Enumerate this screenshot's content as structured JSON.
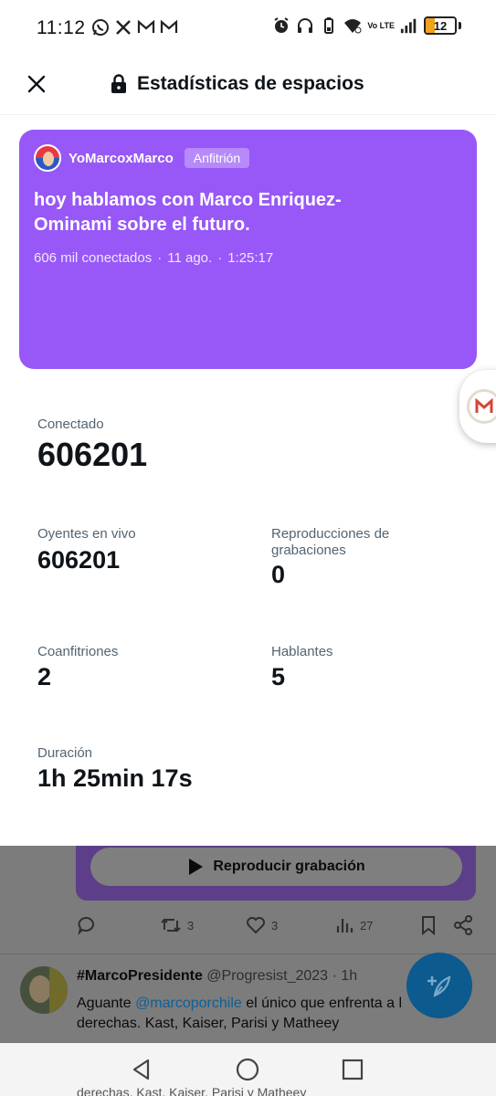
{
  "status_bar": {
    "time": "11:12",
    "battery": "12",
    "network": "Vo LTE"
  },
  "header": {
    "title": "Estadísticas de espacios"
  },
  "space": {
    "host_name": "YoMarcoxMarco",
    "host_badge": "Anfitrión",
    "title": "hoy hablamos con Marco Enriquez-Ominami sobre el futuro.",
    "connected": "606 mil conectados",
    "date": "11 ago.",
    "duration": "1:25:17",
    "card_color": "#9858f7"
  },
  "stats": {
    "connected_label": "Conectado",
    "connected_value": "606201",
    "live_listeners_label": "Oyentes en vivo",
    "live_listeners_value": "606201",
    "replays_label_line1": "Reproducciones de",
    "replays_label_line2": "grabaciones",
    "replays_value": "0",
    "cohosts_label": "Coanfitriones",
    "cohosts_value": "2",
    "speakers_label": "Hablantes",
    "speakers_value": "5",
    "duration_label": "Duración",
    "duration_value": "1h 25min 17s"
  },
  "background_feed": {
    "play_recording_label": "Reproducir grabación",
    "retweets": "3",
    "likes": "3",
    "views": "27",
    "tweet_name": "#MarcoPresidente",
    "tweet_handle": "@Progresist_2023",
    "tweet_time": "1h",
    "tweet_text_before": "Aguante ",
    "tweet_mention": "@marcoporchile",
    "tweet_text_after": " el único que enfrenta a l",
    "tweet_text_line2": "derechas. Kast, Kaiser, Parisi y Matheey",
    "tweet_text_ghost": "derechas. Kast, Kaiser, Parisi y Matheey"
  },
  "icons": {
    "close": "close-icon",
    "lock": "lock-icon",
    "play": "play-icon",
    "reply": "reply-icon",
    "retweet": "retweet-icon",
    "like": "heart-icon",
    "views": "views-icon",
    "bookmark": "bookmark-icon",
    "share": "share-icon",
    "compose": "compose-icon"
  }
}
